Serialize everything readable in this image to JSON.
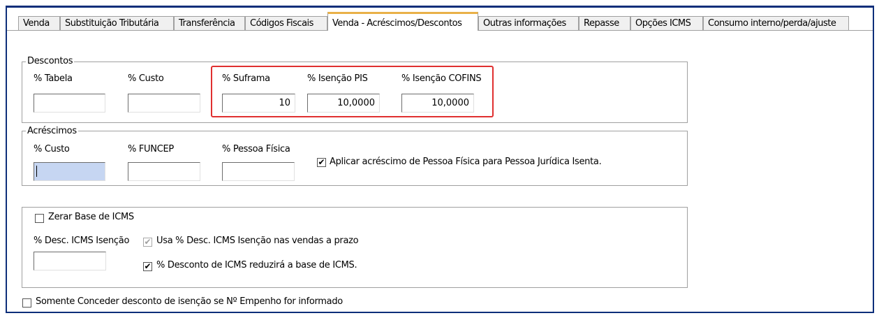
{
  "tabs": [
    {
      "label": "Venda",
      "active": false
    },
    {
      "label": "Substituição Tributária",
      "active": false
    },
    {
      "label": "Transferência",
      "active": false
    },
    {
      "label": "Códigos Fiscais",
      "active": false
    },
    {
      "label": "Venda - Acréscimos/Descontos",
      "active": true
    },
    {
      "label": "Outras informações",
      "active": false
    },
    {
      "label": "Repasse",
      "active": false
    },
    {
      "label": "Opções ICMS",
      "active": false
    },
    {
      "label": "Consumo interno/perda/ajuste",
      "active": false
    }
  ],
  "descontos": {
    "title": "Descontos",
    "tabela_label": "% Tabela",
    "tabela_value": "",
    "custo_label": "% Custo",
    "custo_value": "",
    "suframa_label": "% Suframa",
    "suframa_value": "10",
    "pis_label": "% Isenção PIS",
    "pis_value": "10,0000",
    "cofins_label": "% Isenção COFINS",
    "cofins_value": "10,0000"
  },
  "acrescimos": {
    "title": "Acréscimos",
    "custo_label": "% Custo",
    "custo_value": "",
    "funcep_label": "% FUNCEP",
    "funcep_value": "",
    "pf_label": "% Pessoa Física",
    "pf_value": "",
    "aplicar_label": "Aplicar acréscimo de Pessoa Física para Pessoa Jurídica Isenta.",
    "aplicar_checked": true
  },
  "icms": {
    "zerar_label": "Zerar Base de ICMS",
    "zerar_checked": false,
    "desc_label": "% Desc. ICMS Isenção",
    "desc_value": "",
    "usa_label": "Usa % Desc. ICMS Isenção nas vendas a prazo",
    "usa_checked": true,
    "reduz_label": "% Desconto de ICMS reduzirá a base de ICMS.",
    "reduz_checked": true
  },
  "empenho": {
    "label": "Somente Conceder desconto de isenção se Nº Empenho for informado",
    "checked": false
  },
  "colors": {
    "frame": "#0d2e7a",
    "active_tab_accent": "#e9b148",
    "highlight": "#e03030",
    "focused_input": "#c6d6f2"
  }
}
